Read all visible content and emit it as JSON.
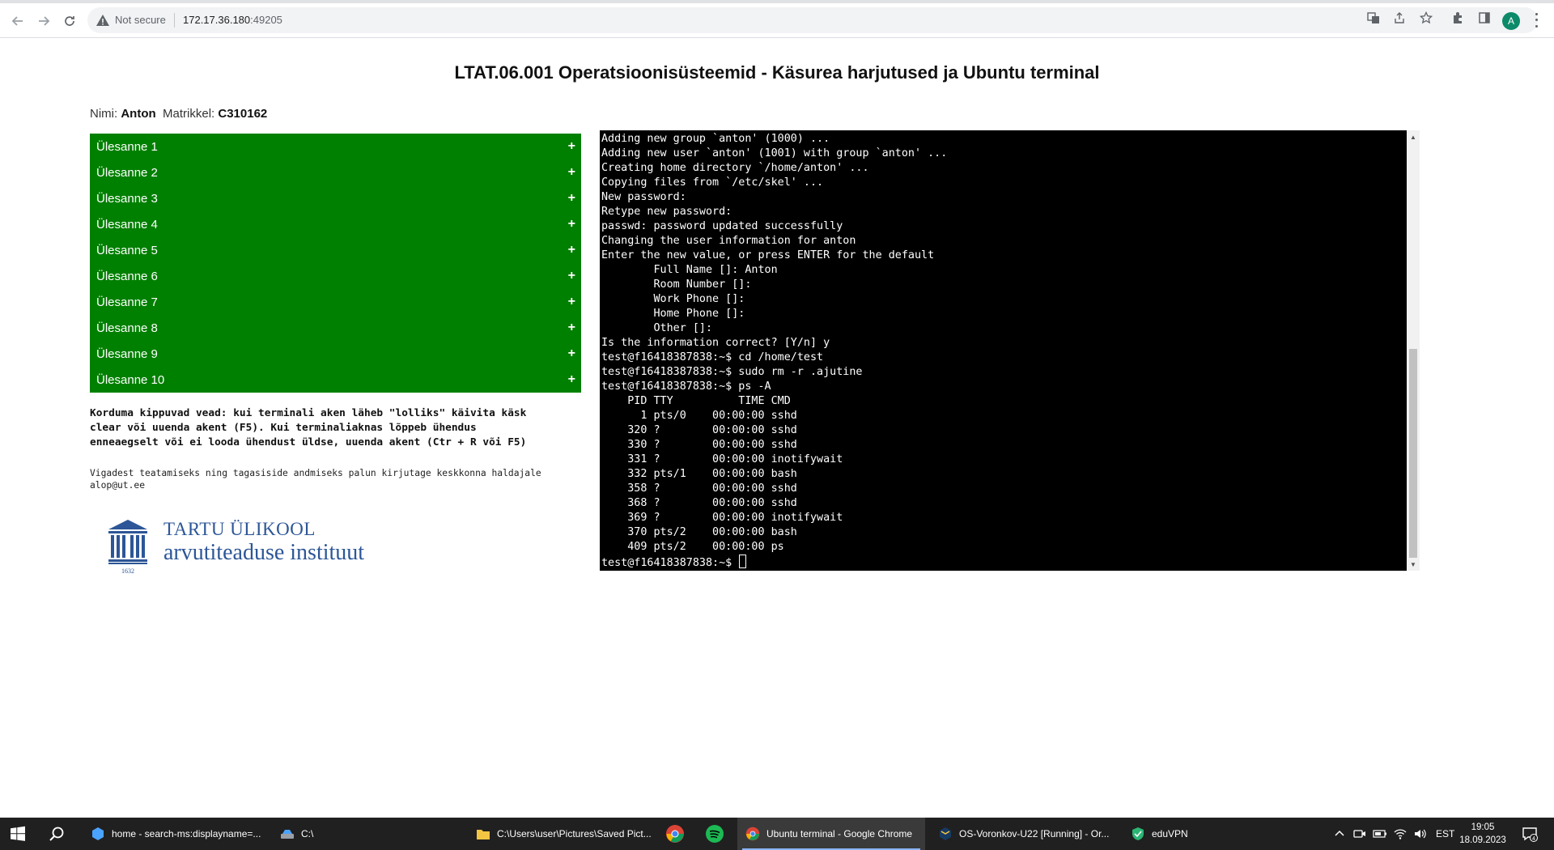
{
  "browser": {
    "security_label": "Not secure",
    "url_host": "172.17.36.180",
    "url_port": ":49205",
    "profile_initial": "A"
  },
  "page": {
    "title": "LTAT.06.001 Operatsioonisüsteemid - Käsurea harjutused ja Ubuntu terminal",
    "name_label": "Nimi:",
    "name_value": "Anton",
    "matrikkel_label": "Matrikkel:",
    "matrikkel_value": "C310162",
    "tasks": [
      {
        "label": "Ülesanne 1",
        "toggle": "+"
      },
      {
        "label": "Ülesanne 2",
        "toggle": "+"
      },
      {
        "label": "Ülesanne 3",
        "toggle": "+"
      },
      {
        "label": "Ülesanne 4",
        "toggle": "+"
      },
      {
        "label": "Ülesanne 5",
        "toggle": "+"
      },
      {
        "label": "Ülesanne 6",
        "toggle": "+"
      },
      {
        "label": "Ülesanne 7",
        "toggle": "+"
      },
      {
        "label": "Ülesanne 8",
        "toggle": "+"
      },
      {
        "label": "Ülesanne 9",
        "toggle": "+"
      },
      {
        "label": "Ülesanne 10",
        "toggle": "+"
      }
    ],
    "warning_lines": [
      "Korduma kippuvad vead: kui terminali aken läheb \"lolliks\" käivita käsk",
      "clear või uuenda akent (F5). Kui terminaliaknas lõppeb ühendus",
      "enneaegselt või ei looda ühendust üldse, uuenda akent (Ctr + R või F5)"
    ],
    "contact_lines": [
      "Vigadest teatamiseks ning tagasiside andmiseks palun kirjutage keskkonna haldajale",
      "alop@ut.ee"
    ],
    "logo": {
      "line1": "TARTU ÜLIKOOL",
      "line2": "arvutiteaduse instituut",
      "year": "1632",
      "color": "#2c5697"
    },
    "accent_green": "#008000"
  },
  "terminal": {
    "lines": [
      "Adding new group `anton' (1000) ...",
      "Adding new user `anton' (1001) with group `anton' ...",
      "Creating home directory `/home/anton' ...",
      "Copying files from `/etc/skel' ...",
      "New password:",
      "Retype new password:",
      "passwd: password updated successfully",
      "Changing the user information for anton",
      "Enter the new value, or press ENTER for the default",
      "        Full Name []: Anton",
      "        Room Number []:",
      "        Work Phone []:",
      "        Home Phone []:",
      "        Other []:",
      "Is the information correct? [Y/n] y",
      "test@f16418387838:~$ cd /home/test",
      "test@f16418387838:~$ sudo rm -r .ajutine",
      "test@f16418387838:~$ ps -A",
      "    PID TTY          TIME CMD",
      "      1 pts/0    00:00:00 sshd",
      "    320 ?        00:00:00 sshd",
      "    330 ?        00:00:00 sshd",
      "    331 ?        00:00:00 inotifywait",
      "    332 pts/1    00:00:00 bash",
      "    358 ?        00:00:00 sshd",
      "    368 ?        00:00:00 sshd",
      "    369 ?        00:00:00 inotifywait",
      "    370 pts/2    00:00:00 bash",
      "    409 pts/2    00:00:00 ps"
    ],
    "prompt": "test@f16418387838:~$ "
  },
  "taskbar": {
    "items": [
      {
        "label": "home - search-ms:displayname=...",
        "icon": "explorer-search-icon"
      },
      {
        "label": "C:\\",
        "icon": "drive-icon"
      },
      {
        "label": "C:\\Users\\user\\Pictures\\Saved Pict...",
        "icon": "folder-icon"
      },
      {
        "label": "Ubuntu terminal - Google Chrome",
        "icon": "chrome-icon"
      },
      {
        "label": "OS-Voronkov-U22 [Running] - Or...",
        "icon": "virtualbox-icon"
      },
      {
        "label": "eduVPN",
        "icon": "eduvpn-icon"
      }
    ],
    "input_lang": "EST",
    "time": "19:05",
    "date": "18.09.2023",
    "notification_count": "4"
  }
}
